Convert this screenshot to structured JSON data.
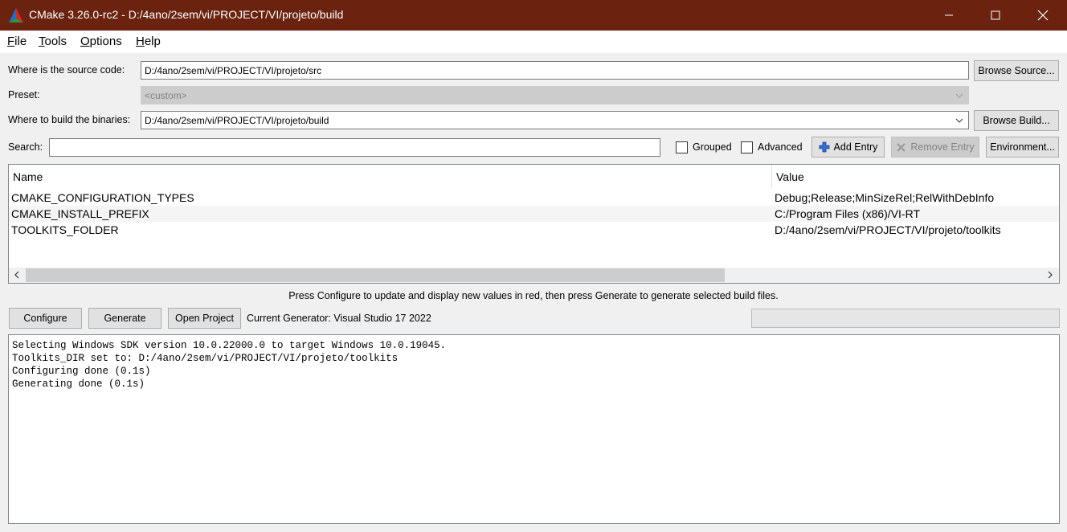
{
  "window": {
    "title": "CMake 3.26.0-rc2 - D:/4ano/2sem/vi/PROJECT/VI/projeto/build",
    "titlebar_color": "#6b2310"
  },
  "menu": {
    "items": [
      "File",
      "Tools",
      "Options",
      "Help"
    ]
  },
  "source": {
    "label": "Where is the source code:",
    "value": "D:/4ano/2sem/vi/PROJECT/VI/projeto/src",
    "browse_label": "Browse Source..."
  },
  "preset": {
    "label": "Preset:",
    "value": "<custom>"
  },
  "binaries": {
    "label": "Where to build the binaries:",
    "value": "D:/4ano/2sem/vi/PROJECT/VI/projeto/build",
    "browse_label": "Browse Build..."
  },
  "search": {
    "label": "Search:",
    "value": "",
    "grouped_label": "Grouped",
    "grouped_checked": false,
    "advanced_label": "Advanced",
    "advanced_checked": false,
    "add_entry_label": "Add Entry",
    "remove_entry_label": "Remove Entry",
    "environment_label": "Environment..."
  },
  "table": {
    "columns": [
      "Name",
      "Value"
    ],
    "rows": [
      {
        "name": "CMAKE_CONFIGURATION_TYPES",
        "value": "Debug;Release;MinSizeRel;RelWithDebInfo"
      },
      {
        "name": "CMAKE_INSTALL_PREFIX",
        "value": "C:/Program Files (x86)/VI-RT"
      },
      {
        "name": "TOOLKITS_FOLDER",
        "value": "D:/4ano/2sem/vi/PROJECT/VI/projeto/toolkits"
      }
    ]
  },
  "hint": "Press Configure to update and display new values in red, then press Generate to generate selected build files.",
  "actions": {
    "configure_label": "Configure",
    "generate_label": "Generate",
    "open_project_label": "Open Project",
    "generator_text": "Current Generator: Visual Studio 17 2022"
  },
  "progress": 0,
  "output": {
    "lines": [
      "Selecting Windows SDK version 10.0.22000.0 to target Windows 10.0.19045.",
      "Toolkits_DIR set to: D:/4ano/2sem/vi/PROJECT/VI/projeto/toolkits",
      "Configuring done (0.1s)",
      "Generating done (0.1s)"
    ]
  }
}
